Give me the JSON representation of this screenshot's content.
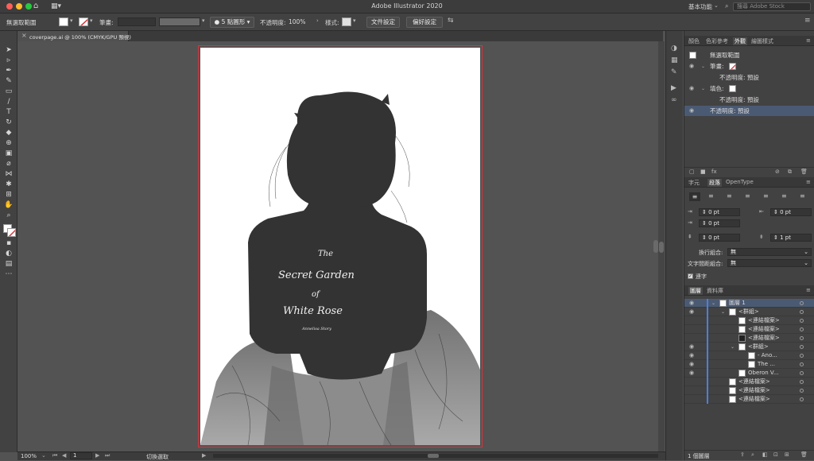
{
  "window": {
    "title": "Adobe Illustrator 2020",
    "workspace": "基本功能",
    "search_placeholder": "搜尋 Adobe Stock"
  },
  "control_bar": {
    "selection_label": "無選取範圍",
    "stroke_label": "筆畫:",
    "brush_value": "5 點圓形",
    "opacity_label": "不透明度:",
    "opacity_value": "100%",
    "style_label": "樣式:",
    "doc_setup_button": "文件設定",
    "preferences_button": "偏好設定"
  },
  "document_tab": {
    "label": "coverpage.ai @ 100% (CMYK/GPU 預視)"
  },
  "artwork": {
    "line1": "The",
    "line2": "Secret Garden",
    "line3": "of",
    "line4": "White Rose",
    "author": "Annelisa Story"
  },
  "status_bar": {
    "zoom": "100%",
    "page": "1",
    "mode": "切換選取"
  },
  "appearance_panel": {
    "tabs": [
      "顏色",
      "色彩參考",
      "外觀",
      "繪圖樣式"
    ],
    "active_tab": "外觀",
    "rows": [
      {
        "label": "無選取範圍"
      },
      {
        "label": "筆畫:"
      },
      {
        "label": "不透明度: 預設"
      },
      {
        "label": "填色:"
      },
      {
        "label": "不透明度: 預設"
      },
      {
        "label": "不透明度: 預設"
      }
    ]
  },
  "paragraph_panel": {
    "tabs": [
      "字元",
      "段落",
      "OpenType"
    ],
    "active_tab": "段落",
    "fields": {
      "left_indent": "0 pt",
      "right_indent": "0 pt",
      "first_line": "0 pt",
      "space_before": "0 pt",
      "space_after": "1 pt"
    },
    "composer_label": "換行組合:",
    "composer_value": "無",
    "spacing_label": "文字間距組合:",
    "spacing_value": "無",
    "hyphenate_label": "連字"
  },
  "layers_panel": {
    "tabs": [
      "圖層",
      "資料庫"
    ],
    "active_tab": "圖層",
    "rows": [
      {
        "label": "圖層 1"
      },
      {
        "label": "<群組>"
      },
      {
        "label": "<連結檔案>"
      },
      {
        "label": "<連結檔案>"
      },
      {
        "label": "<連結檔案>"
      },
      {
        "label": "<群組>"
      },
      {
        "label": "- Ano..."
      },
      {
        "label": "The ..."
      },
      {
        "label": "Oberon V..."
      },
      {
        "label": "<連結檔案>"
      },
      {
        "label": "<連結檔案>"
      },
      {
        "label": "<連結檔案>"
      }
    ],
    "count": "1 個圖層"
  },
  "colors": {
    "artboard_border": "#d0373f",
    "layer_highlight": "#4a7fe0",
    "selected_row": "#4b5a73"
  }
}
